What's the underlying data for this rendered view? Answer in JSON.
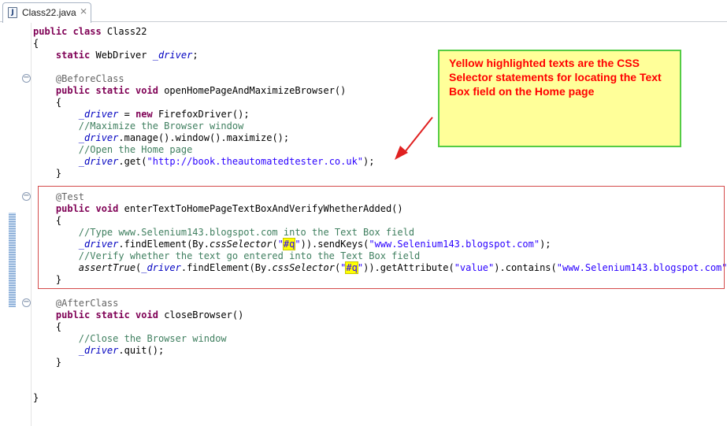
{
  "tab": {
    "title": "Class22.java",
    "file_icon_letter": "J",
    "close_symbol": "⨯"
  },
  "code_lines": [
    [
      {
        "c": "kw",
        "t": "public class "
      },
      {
        "c": "",
        "t": "Class22"
      }
    ],
    [
      {
        "c": "",
        "t": "{"
      }
    ],
    [
      {
        "c": "",
        "t": "    "
      },
      {
        "c": "kw",
        "t": "static "
      },
      {
        "c": "",
        "t": "WebDriver "
      },
      {
        "c": "fld",
        "t": "_driver"
      },
      {
        "c": "",
        "t": ";"
      }
    ],
    [],
    [
      {
        "c": "",
        "t": "    "
      },
      {
        "c": "ann",
        "t": "@BeforeClass"
      }
    ],
    [
      {
        "c": "",
        "t": "    "
      },
      {
        "c": "kw",
        "t": "public static void "
      },
      {
        "c": "",
        "t": "openHomePageAndMaximizeBrowser()"
      }
    ],
    [
      {
        "c": "",
        "t": "    {"
      }
    ],
    [
      {
        "c": "",
        "t": "        "
      },
      {
        "c": "fld",
        "t": "_driver"
      },
      {
        "c": "",
        "t": " = "
      },
      {
        "c": "kw",
        "t": "new "
      },
      {
        "c": "",
        "t": "FirefoxDriver();"
      }
    ],
    [
      {
        "c": "",
        "t": "        "
      },
      {
        "c": "cm",
        "t": "//Maximize the Browser window"
      }
    ],
    [
      {
        "c": "",
        "t": "        "
      },
      {
        "c": "fld",
        "t": "_driver"
      },
      {
        "c": "",
        "t": ".manage().window().maximize();"
      }
    ],
    [
      {
        "c": "",
        "t": "        "
      },
      {
        "c": "cm",
        "t": "//Open the Home page"
      }
    ],
    [
      {
        "c": "",
        "t": "        "
      },
      {
        "c": "fld",
        "t": "_driver"
      },
      {
        "c": "",
        "t": ".get("
      },
      {
        "c": "st",
        "t": "\"http://book.theautomatedtester.co.uk\""
      },
      {
        "c": "",
        "t": ");"
      }
    ],
    [
      {
        "c": "",
        "t": "    }"
      }
    ],
    [],
    [
      {
        "c": "",
        "t": "    "
      },
      {
        "c": "ann",
        "t": "@Test"
      }
    ],
    [
      {
        "c": "",
        "t": "    "
      },
      {
        "c": "kw",
        "t": "public void "
      },
      {
        "c": "",
        "t": "enterTextToHomePageTextBoxAndVerifyWhetherAdded()"
      }
    ],
    [
      {
        "c": "",
        "t": "    {"
      }
    ],
    [
      {
        "c": "",
        "t": "        "
      },
      {
        "c": "cm",
        "t": "//Type www.Selenium143.blogspot.com into the Text Box field"
      }
    ],
    [
      {
        "c": "",
        "t": "        "
      },
      {
        "c": "fld",
        "t": "_driver"
      },
      {
        "c": "",
        "t": ".findElement(By."
      },
      {
        "c": "it",
        "t": "cssSelector"
      },
      {
        "c": "",
        "t": "("
      },
      {
        "c": "st",
        "t": "\""
      },
      {
        "c": "hl",
        "t": "#q"
      },
      {
        "c": "st",
        "t": "\""
      },
      {
        "c": "",
        "t": ")).sendKeys("
      },
      {
        "c": "st",
        "t": "\"www.Selenium143.blogspot.com\""
      },
      {
        "c": "",
        "t": ");"
      }
    ],
    [
      {
        "c": "",
        "t": "        "
      },
      {
        "c": "cm",
        "t": "//Verify whether the text go entered into the Text Box field"
      }
    ],
    [
      {
        "c": "",
        "t": "        "
      },
      {
        "c": "it",
        "t": "assertTrue"
      },
      {
        "c": "",
        "t": "("
      },
      {
        "c": "fld",
        "t": "_driver"
      },
      {
        "c": "",
        "t": ".findElement(By."
      },
      {
        "c": "it",
        "t": "cssSelector"
      },
      {
        "c": "",
        "t": "("
      },
      {
        "c": "st",
        "t": "\""
      },
      {
        "c": "hl",
        "t": "#q"
      },
      {
        "c": "st",
        "t": "\""
      },
      {
        "c": "",
        "t": ")).getAttribute("
      },
      {
        "c": "st",
        "t": "\"value\""
      },
      {
        "c": "",
        "t": ").contains("
      },
      {
        "c": "st",
        "t": "\"www.Selenium143.blogspot.com\""
      },
      {
        "c": "",
        "t": "));"
      }
    ],
    [
      {
        "c": "",
        "t": "    }"
      }
    ],
    [],
    [
      {
        "c": "",
        "t": "    "
      },
      {
        "c": "ann",
        "t": "@AfterClass"
      }
    ],
    [
      {
        "c": "",
        "t": "    "
      },
      {
        "c": "kw",
        "t": "public static void "
      },
      {
        "c": "",
        "t": "closeBrowser()"
      }
    ],
    [
      {
        "c": "",
        "t": "    {"
      }
    ],
    [
      {
        "c": "",
        "t": "        "
      },
      {
        "c": "cm",
        "t": "//Close the Browser window"
      }
    ],
    [
      {
        "c": "",
        "t": "        "
      },
      {
        "c": "fld",
        "t": "_driver"
      },
      {
        "c": "",
        "t": ".quit();"
      }
    ],
    [
      {
        "c": "",
        "t": "    }"
      }
    ],
    [],
    [],
    [
      {
        "c": "",
        "t": "}"
      }
    ]
  ],
  "note": {
    "text": "Yellow highlighted texts are the CSS Selector statements for locating the Text Box field on the Home page"
  },
  "colors": {
    "keyword": "#7f0055",
    "annotation": "#646464",
    "comment": "#3f7f5f",
    "string": "#2a00ff",
    "field": "#0000c0",
    "highlight": "#ffff00",
    "note_bg": "#ffff99",
    "note_border": "#55cc44",
    "note_text": "#ff0000",
    "box_border": "#d44a4a"
  },
  "icons": {
    "tab_file": "java-file-icon",
    "tab_close": "close-icon",
    "fold": "fold-collapse-icon",
    "arrow": "red-arrow-icon"
  }
}
